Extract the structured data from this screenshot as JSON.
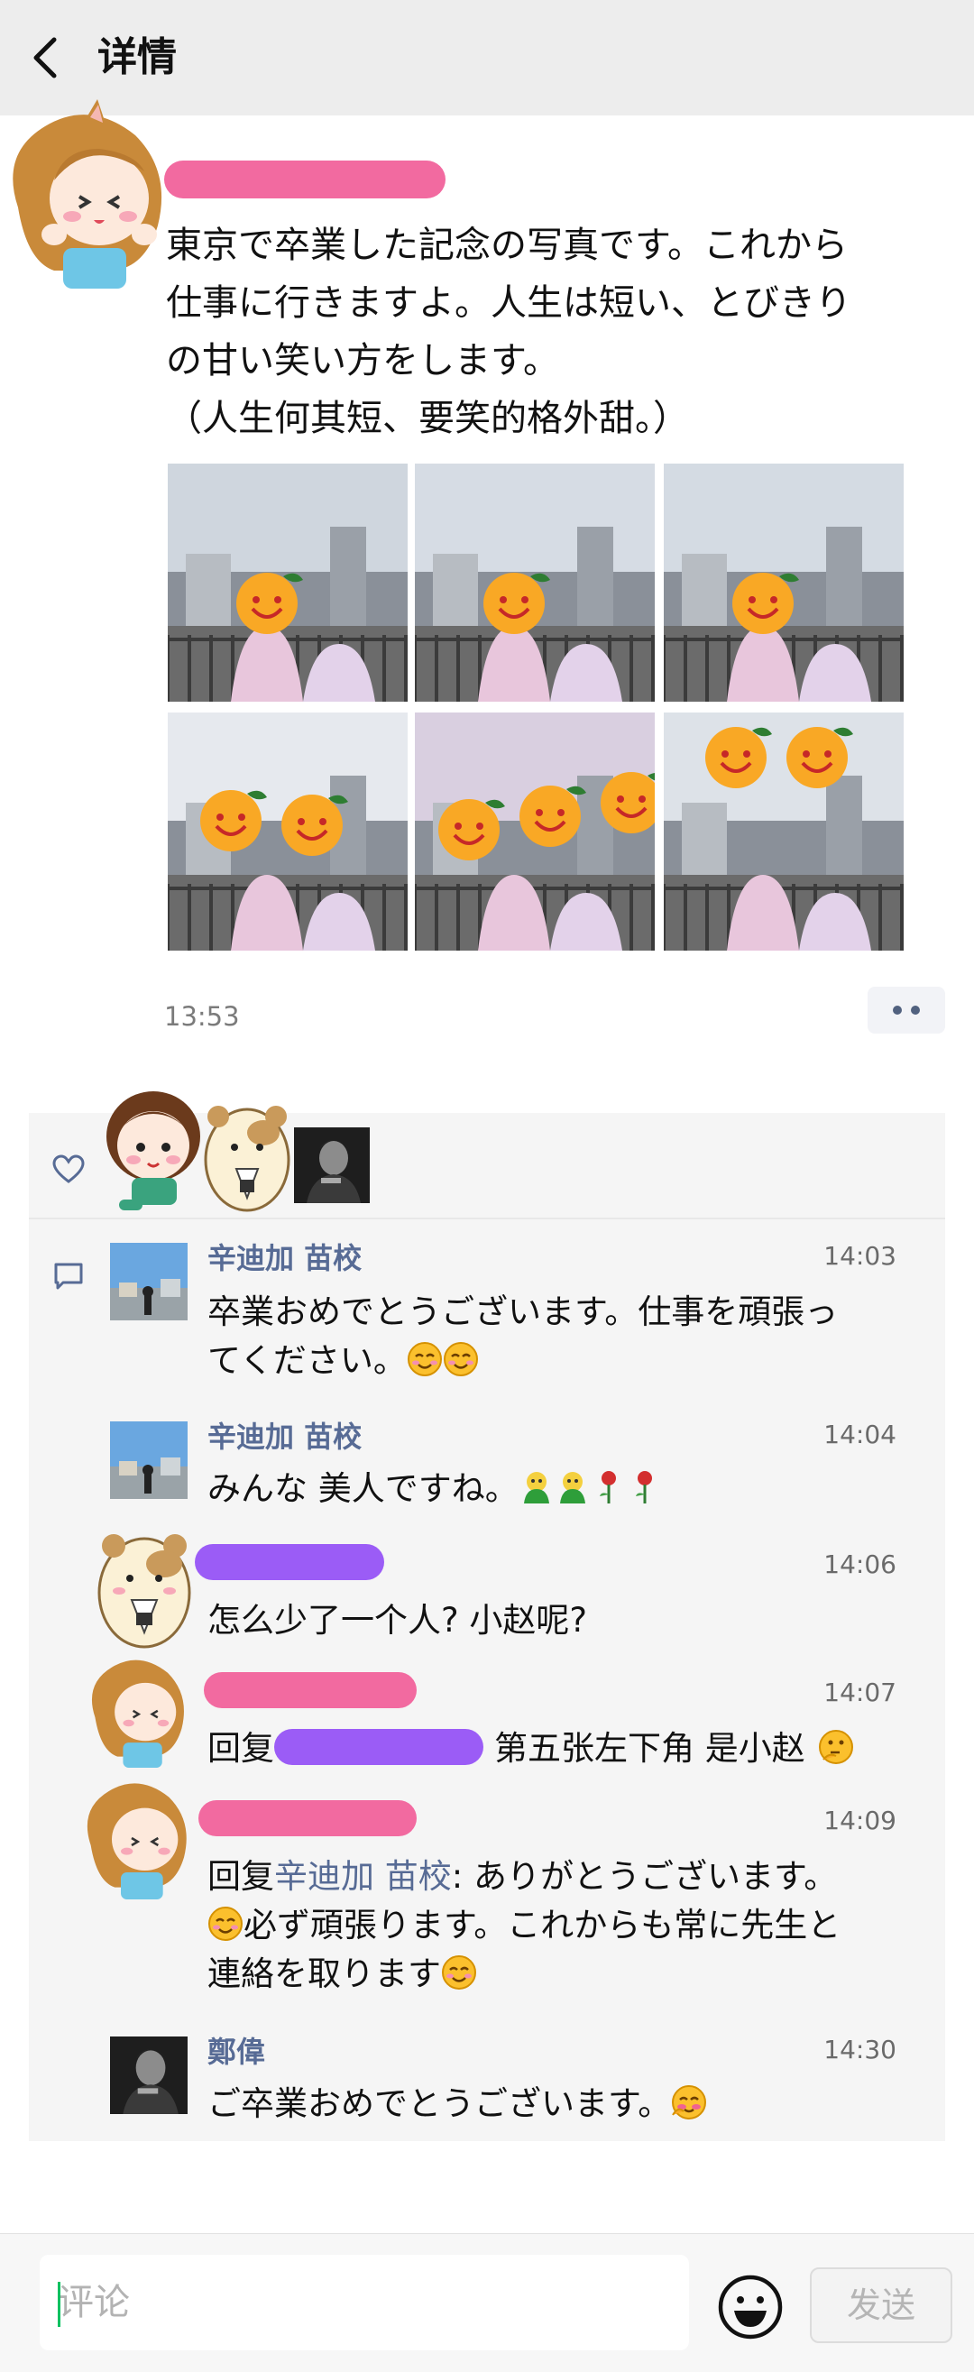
{
  "header": {
    "title": "详情",
    "back_icon": "chevron-left-icon"
  },
  "post": {
    "lines": [
      "東京で卒業した記念の写真です。これから",
      "仕事に行きますよ。人生は短い、とびきり",
      "の甘い笑い方をします。",
      "（人生何其短、要笑的格外甜。）"
    ],
    "photo_count": 6,
    "time": "13:53"
  },
  "colors": {
    "name_blob_pink": "#f26aa0",
    "name_blob_purple": "#9b5cf6",
    "link_blue": "#576b95",
    "accent_green": "#07c160"
  },
  "likes": {
    "icon": "heart-outline-icon",
    "count_avatars": 3
  },
  "comments": [
    {
      "name": "辛迪加 苗校",
      "time": "14:03",
      "text_lines": [
        "卒業おめでとうございます。仕事を頑張っ",
        "てください。"
      ]
    },
    {
      "name": "辛迪加 苗校",
      "time": "14:04",
      "text": "みんな 美人ですね。"
    },
    {
      "time": "14:06",
      "text": "怎么少了一个人? 小赵呢?"
    },
    {
      "time": "14:07",
      "reply_prefix": "回复",
      "text": "第五张左下角 是小赵"
    },
    {
      "time": "14:09",
      "reply_prefix": "回复",
      "reply_to": "辛迪加 苗校",
      "reply_sep": ": ",
      "text_lines": [
        "ありがとうございます。",
        "必ず頑張ります。これからも常に先生と",
        "連絡を取ります"
      ]
    },
    {
      "name": "鄭偉",
      "time": "14:30",
      "text": "ご卒業おめでとうございます。"
    }
  ],
  "input": {
    "placeholder": "评论",
    "value": ""
  },
  "send_label": "发送",
  "emoji_button_icon": "smiley-icon"
}
